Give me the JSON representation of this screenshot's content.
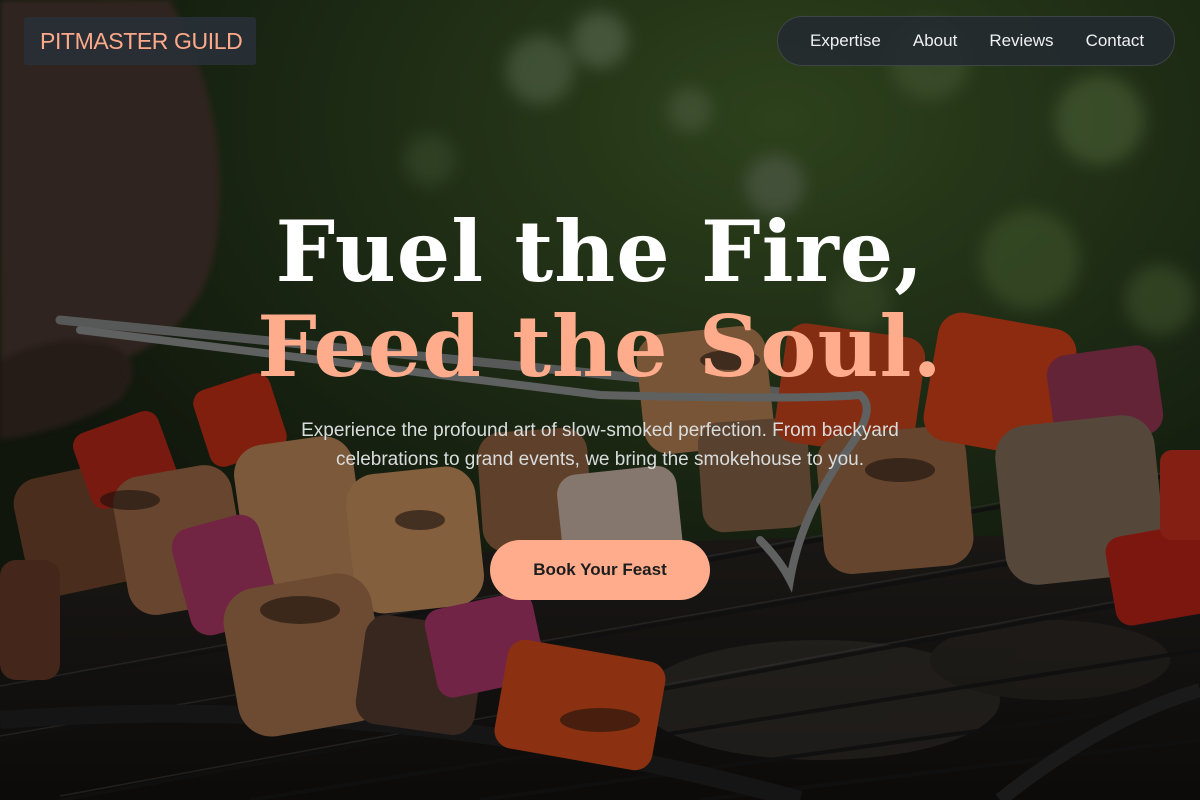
{
  "brand": {
    "logo_text": "PITMASTER GUILD"
  },
  "nav": {
    "items": [
      {
        "label": "Expertise"
      },
      {
        "label": "About"
      },
      {
        "label": "Reviews"
      },
      {
        "label": "Contact"
      }
    ]
  },
  "hero": {
    "headline_line1": "Fuel the Fire,",
    "headline_line2": "Feed the Soul.",
    "subtext": "Experience the profound art of slow-smoked perfection. From backyard celebrations to grand events, we bring the smokehouse to you.",
    "cta_label": "Book Your Feast",
    "background_image": "grilled-kebab-skewers-photo"
  },
  "colors": {
    "accent": "#ffac8c",
    "logo_text": "#fda98a",
    "heading": "#ffffff",
    "nav_background": "#283038"
  }
}
